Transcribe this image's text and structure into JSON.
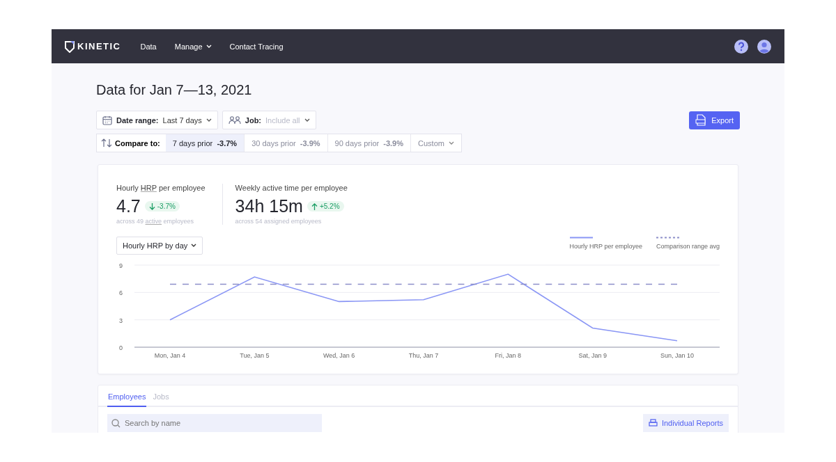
{
  "nav": {
    "brand": "KINETIC",
    "links": [
      {
        "label": "Data",
        "dropdown": false
      },
      {
        "label": "Manage",
        "dropdown": true
      },
      {
        "label": "Contact Tracing",
        "dropdown": false
      }
    ]
  },
  "title": "Data for Jan 7—13, 2021",
  "filters": [
    {
      "kind": "calendar",
      "label": "Date range:",
      "value": "Last 7 days",
      "muted": false
    },
    {
      "kind": "people",
      "label": "Job:",
      "value": "Include all",
      "muted": true
    }
  ],
  "export_button": "Export",
  "compare": {
    "label": "Compare to:",
    "options": [
      {
        "label": "7 days prior",
        "change": "-3.7%",
        "selected": true
      },
      {
        "label": "30 days prior",
        "change": "-3.9%",
        "selected": false
      },
      {
        "label": "90 days prior",
        "change": "-3.9%",
        "selected": false
      }
    ],
    "custom": "Custom"
  },
  "metrics": [
    {
      "label": [
        {
          "text": "Hourly ",
          "underline": false
        },
        {
          "text": "HRP",
          "underline": true
        },
        {
          "text": " per employee",
          "underline": false
        }
      ],
      "value": "4.7",
      "change": "-3.7%",
      "rising": false,
      "note": [
        {
          "text": "across 49 ",
          "underline": false
        },
        {
          "text": "active",
          "underline": true
        },
        {
          "text": " employees",
          "underline": false
        }
      ]
    },
    {
      "label": [
        {
          "text": "Weekly active time per employee",
          "underline": false
        }
      ],
      "value": "34h 15m",
      "change": "+5.2%",
      "rising": true,
      "note": [
        {
          "text": "across 54 assigned employees",
          "underline": false
        }
      ]
    }
  ],
  "chart_select": "Hourly HRP by day",
  "chart_data": {
    "type": "line",
    "categories": [
      "Mon, Jan 4",
      "Tue, Jan 5",
      "Wed, Jan 6",
      "Thu, Jan 7",
      "Fri, Jan 8",
      "Sat, Jan 9",
      "Sun, Jan 10"
    ],
    "series": [
      {
        "name": "Hourly HRP per employee",
        "color": "#8a96f5",
        "line_style": "solid",
        "values": [
          3,
          7.7,
          5,
          5.2,
          8,
          2.1,
          0.7
        ]
      },
      {
        "name": "Comparison range avg",
        "color": "#8d8fc9",
        "line_style": "dashed",
        "values": [
          6.9,
          6.9,
          6.9,
          6.9,
          6.9,
          6.9,
          6.9
        ]
      }
    ],
    "ylim": [
      0,
      9
    ],
    "yticks": [
      0,
      3,
      6,
      9
    ]
  },
  "tabs": [
    {
      "label": "Employees",
      "selected": true
    },
    {
      "label": "Jobs",
      "selected": false
    }
  ],
  "search": {
    "placeholder": "Search by name"
  },
  "reports_button": "Individual Reports"
}
